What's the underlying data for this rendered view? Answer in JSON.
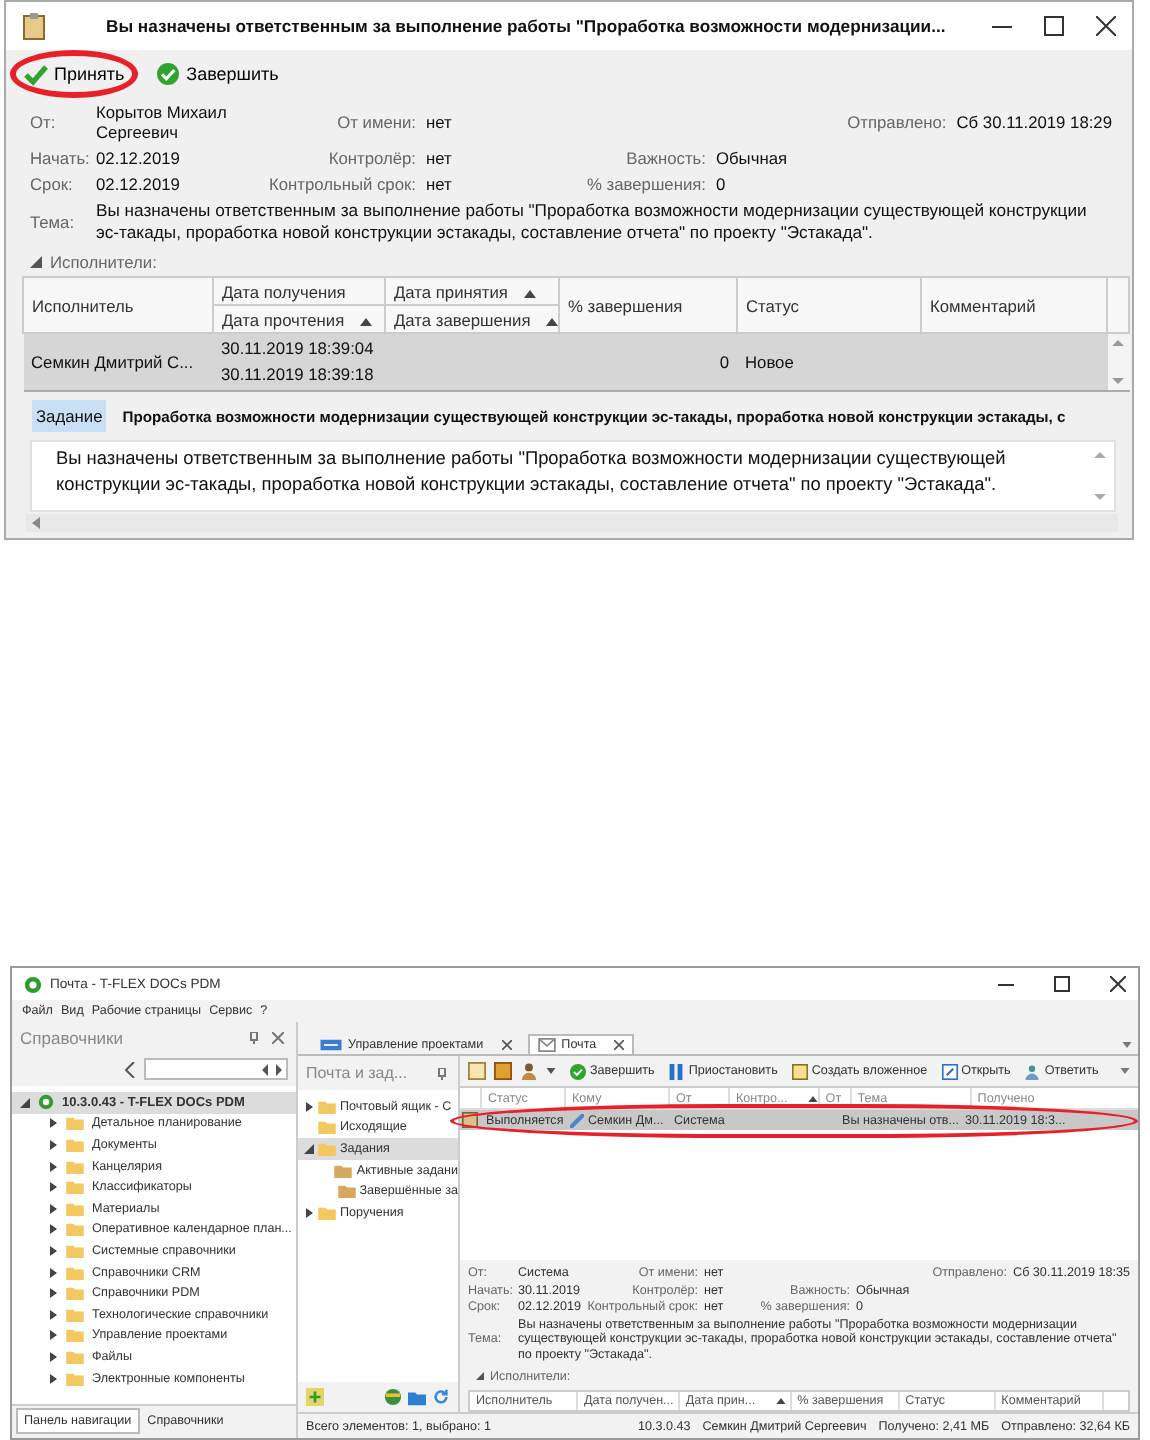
{
  "dialog": {
    "title": "Вы назначены ответственным за выполнение работы \"Проработка возможности модернизации...",
    "toolbar": [
      {
        "label": "Принять",
        "highlighted": true
      },
      {
        "label": "Завершить",
        "highlighted": false
      }
    ],
    "fields": [
      [
        {
          "label": "От:",
          "value": "Корытов Михаил Сергеевич"
        },
        {
          "label": "От имени:",
          "value": "нет"
        },
        {
          "label": "Отправлено:",
          "value": "Сб 30.11.2019 18:29"
        }
      ],
      [
        {
          "label": "Начать:",
          "value": "02.12.2019"
        },
        {
          "label": "Контролёр:",
          "value": "нет"
        },
        {
          "label": "Важность:",
          "value": "Обычная"
        }
      ],
      [
        {
          "label": "Срок:",
          "value": "02.12.2019"
        },
        {
          "label": "Контрольный срок:",
          "value": "нет"
        },
        {
          "label": "% завершения:",
          "value": "0"
        }
      ]
    ],
    "subject": {
      "label": "Тема:",
      "value": "Вы назначены ответственным за выполнение работы \"Проработка возможности модернизации существующей конструкции эс-такады, проработка новой конструкции эстакады, составление отчета\" по проекту \"Эстакада\"."
    },
    "performers": {
      "label": "Исполнители:",
      "expanded": true,
      "columns": [
        {
          "kind": "single",
          "label": "Исполнитель",
          "sorted": false
        },
        {
          "kind": "double",
          "top": {
            "label": "Дата получения",
            "sorted": false
          },
          "bottom": {
            "label": "Дата прочтения",
            "sorted": true
          }
        },
        {
          "kind": "double",
          "top": {
            "label": "Дата принятия",
            "sorted": true
          },
          "bottom": {
            "label": "Дата завершения",
            "sorted": true
          }
        },
        {
          "kind": "single",
          "label": "% завершения",
          "sorted": false
        },
        {
          "kind": "single",
          "label": "Статус",
          "sorted": false
        },
        {
          "kind": "single",
          "label": "Комментарий",
          "sorted": false
        }
      ],
      "rows": [
        {
          "selected": true,
          "performer": "Семкин Дмитрий С...",
          "received": "30.11.2019 18:39:04",
          "read": "30.11.2019 18:39:18",
          "completion": "0",
          "status": "Новое"
        }
      ]
    },
    "task_tabs": [
      {
        "label": "Задание",
        "selected": true
      }
    ],
    "task_title": "Проработка возможности модернизации существующей конструкции эс-такады, проработка новой конструкции эстакады, с",
    "body": "Вы назначены ответственным за выполнение работы \"Проработка возможности модернизации существующей конструкции эс-такады, проработка новой конструкции эстакады, составление отчета\" по проекту \"Эстакада\"."
  },
  "app": {
    "title": "Почта - T-FLEX DOCs PDM",
    "menu": [
      "Файл",
      "Вид",
      "Рабочие страницы",
      "Сервис",
      "?"
    ],
    "left_panel": {
      "title": "Справочники",
      "tree": [
        {
          "label": "10.3.0.43 - T-FLEX DOCs PDM",
          "expanded": true,
          "selected": true,
          "children": [
            {
              "label": "Детальное планирование",
              "expanded": false,
              "selected": false
            },
            {
              "label": "Документы",
              "expanded": false,
              "selected": false
            },
            {
              "label": "Канцелярия",
              "expanded": false,
              "selected": false
            },
            {
              "label": "Классификаторы",
              "expanded": false,
              "selected": false
            },
            {
              "label": "Материалы",
              "expanded": false,
              "selected": false
            },
            {
              "label": "Оперативное календарное план...",
              "expanded": false,
              "selected": false
            },
            {
              "label": "Системные справочники",
              "expanded": false,
              "selected": false
            },
            {
              "label": "Справочники CRM",
              "expanded": false,
              "selected": false
            },
            {
              "label": "Справочники PDM",
              "expanded": false,
              "selected": false
            },
            {
              "label": "Технологические справочники",
              "expanded": false,
              "selected": false
            },
            {
              "label": "Управление проектами",
              "expanded": false,
              "selected": false
            },
            {
              "label": "Файлы",
              "expanded": false,
              "selected": false
            },
            {
              "label": "Электронные компоненты",
              "expanded": false,
              "selected": false
            }
          ]
        }
      ],
      "tabs": [
        {
          "label": "Панель навигации",
          "selected": true
        },
        {
          "label": "Справочники",
          "selected": false
        }
      ]
    },
    "doc_tabs": [
      {
        "label": "Управление проектами",
        "selected": false
      },
      {
        "label": "Почта",
        "selected": true
      }
    ],
    "mail_panel": {
      "title": "Почта и зад...",
      "tree": [
        {
          "label": "Почтовый ящик - С",
          "expanded": false,
          "selected": false
        },
        {
          "label": "Исходящие",
          "selected": false
        },
        {
          "label": "Задания",
          "expanded": true,
          "selected": true,
          "children": [
            {
              "label": "Активные задани",
              "selected": false
            },
            {
              "label": "Завершённые за",
              "selected": false
            }
          ]
        },
        {
          "label": "Поручения",
          "expanded": false,
          "selected": false
        }
      ]
    },
    "toolbar": [
      "Завершить",
      "Приостановить",
      "Создать вложенное",
      "Открыть",
      "Ответить"
    ],
    "grid": {
      "columns": [
        {
          "label": "Статус",
          "sorted": false
        },
        {
          "label": "Кому",
          "sorted": false
        },
        {
          "label": "От",
          "sorted": false
        },
        {
          "label": "Контро...",
          "sorted": true
        },
        {
          "label": "От",
          "sorted": false
        },
        {
          "label": "Тема",
          "sorted": false
        },
        {
          "label": "Получено",
          "sorted": false
        }
      ],
      "rows": [
        {
          "selected": true,
          "highlighted": true,
          "status": "Выполняется",
          "to": "Семкин Дм...",
          "from": "Система",
          "subject": "Вы назначены отв...",
          "received": "30.11.2019 18:3..."
        }
      ]
    },
    "preview": {
      "fields": [
        [
          {
            "label": "От:",
            "value": "Система"
          },
          {
            "label": "От имени:",
            "value": "нет"
          },
          {
            "label": "Отправлено:",
            "value": "Сб 30.11.2019 18:35"
          }
        ],
        [
          {
            "label": "Начать:",
            "value": "30.11.2019"
          },
          {
            "label": "Контролёр:",
            "value": "нет"
          },
          {
            "label": "Важность:",
            "value": "Обычная"
          }
        ],
        [
          {
            "label": "Срок:",
            "value": "02.12.2019"
          },
          {
            "label": "Контрольный срок:",
            "value": "нет"
          },
          {
            "label": "% завершения:",
            "value": "0"
          }
        ]
      ],
      "subject": {
        "label": "Тема:",
        "value": "Вы назначены ответственным за выполнение работы \"Проработка возможности модернизации существующей конструкции эс-такады, проработка новой конструкции эстакады, составление отчета\" по проекту \"Эстакада\"."
      },
      "performers_label": "Исполнители:",
      "performers_expanded": true,
      "columns": [
        {
          "label": "Исполнитель",
          "sorted": false
        },
        {
          "label": "Дата получен...",
          "sorted": false
        },
        {
          "label": "Дата прин...",
          "sorted": true
        },
        {
          "label": "% завершения",
          "sorted": false
        },
        {
          "label": "Статус",
          "sorted": false
        },
        {
          "label": "Комментарий",
          "sorted": false
        }
      ]
    },
    "status_bar": [
      "Всего элементов: 1, выбрано: 1",
      "10.3.0.43",
      "Семкин Дмитрий Сергеевич",
      "Получено: 2,41 МБ",
      "Отправлено: 32,64 КБ"
    ]
  }
}
